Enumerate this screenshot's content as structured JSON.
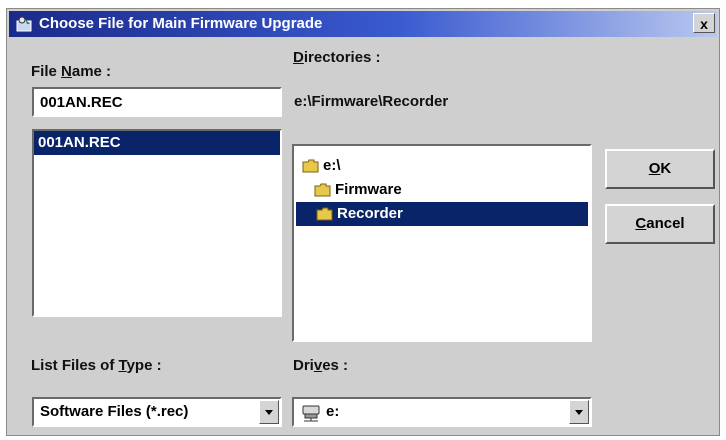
{
  "window": {
    "title": "Choose File for Main Firmware Upgrade",
    "close_label": "x"
  },
  "file_name": {
    "label_pre": "File ",
    "label_hot": "N",
    "label_post": "ame :",
    "value": "001AN.REC",
    "list": [
      "001AN.REC"
    ]
  },
  "directories": {
    "label_hot": "D",
    "label_post": "irectories :",
    "path": "e:\\Firmware\\Recorder",
    "tree": [
      "e:\\",
      "Firmware",
      "Recorder"
    ]
  },
  "buttons": {
    "ok_hot": "O",
    "ok_post": "K",
    "cancel_hot": "C",
    "cancel_post": "ancel"
  },
  "file_type": {
    "label_pre": "List Files of ",
    "label_hot": "T",
    "label_post": "ype :",
    "value": "Software Files (*.rec)"
  },
  "drives": {
    "label_pre": "Dri",
    "label_hot": "v",
    "label_post": "es :",
    "value": "e:"
  }
}
